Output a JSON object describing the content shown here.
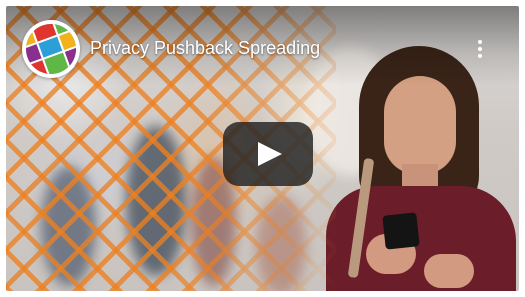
{
  "video": {
    "title": "Privacy Pushback Spreading",
    "channel_logo": "multicolor-globe-logo",
    "menu_icon": "more-vertical-icon",
    "play_icon": "play-icon"
  },
  "colors": {
    "overlay_orange": "#EC8022",
    "play_button_bg": "#212121",
    "title_text": "#FFFFFF"
  }
}
